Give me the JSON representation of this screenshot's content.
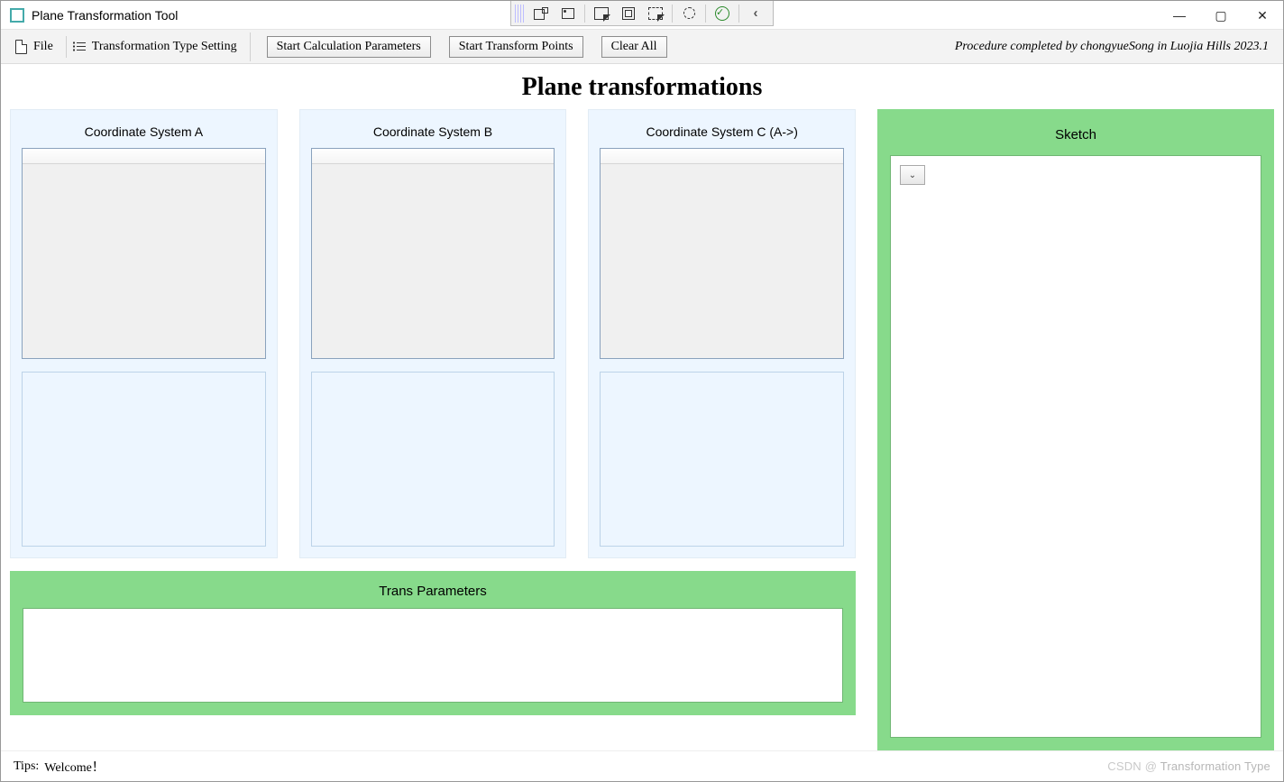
{
  "window": {
    "title": "Plane Transformation Tool"
  },
  "menubar": {
    "file_label": "File",
    "type_setting_label": "Transformation Type Setting",
    "btn_start_calc": "Start Calculation Parameters",
    "btn_start_transform": "Start Transform Points",
    "btn_clear_all": "Clear All",
    "credit": "Procedure completed by chongyueSong in Luojia Hills 2023.1"
  },
  "page": {
    "title": "Plane transformations"
  },
  "panels": {
    "coord_a_title": "Coordinate System A",
    "coord_b_title": "Coordinate System B",
    "coord_c_title": "Coordinate System C (A->)",
    "trans_params_title": "Trans Parameters",
    "sketch_title": "Sketch"
  },
  "statusbar": {
    "tips_label": "Tips:",
    "tips_value": "Welcome！",
    "right_text": "Transformation Type",
    "watermark_prefix": "CSDN @"
  }
}
